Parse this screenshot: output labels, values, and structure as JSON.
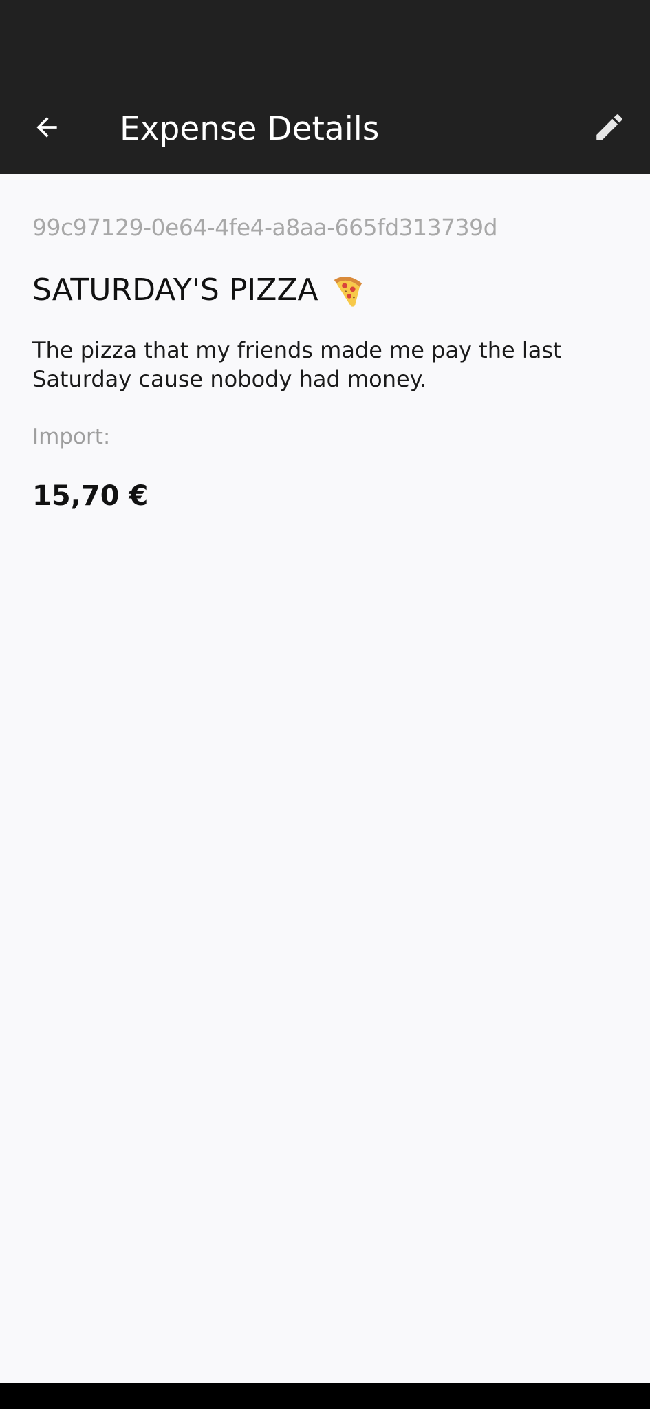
{
  "app_bar": {
    "title": "Expense Details",
    "back_icon": "arrow-back-icon",
    "edit_icon": "pencil-icon",
    "background": "#212121"
  },
  "expense": {
    "id": "99c97129-0e64-4fe4-a8aa-665fd313739d",
    "title": "SATURDAY'S PIZZA",
    "title_icon": "pizza-icon",
    "description": "The pizza that my friends made me pay the last Saturday cause nobody had money.",
    "import_label": "Import:",
    "amount": "15,70 €"
  },
  "colors": {
    "page_background": "#f9f9fb",
    "muted_text": "#a8a8a8"
  }
}
